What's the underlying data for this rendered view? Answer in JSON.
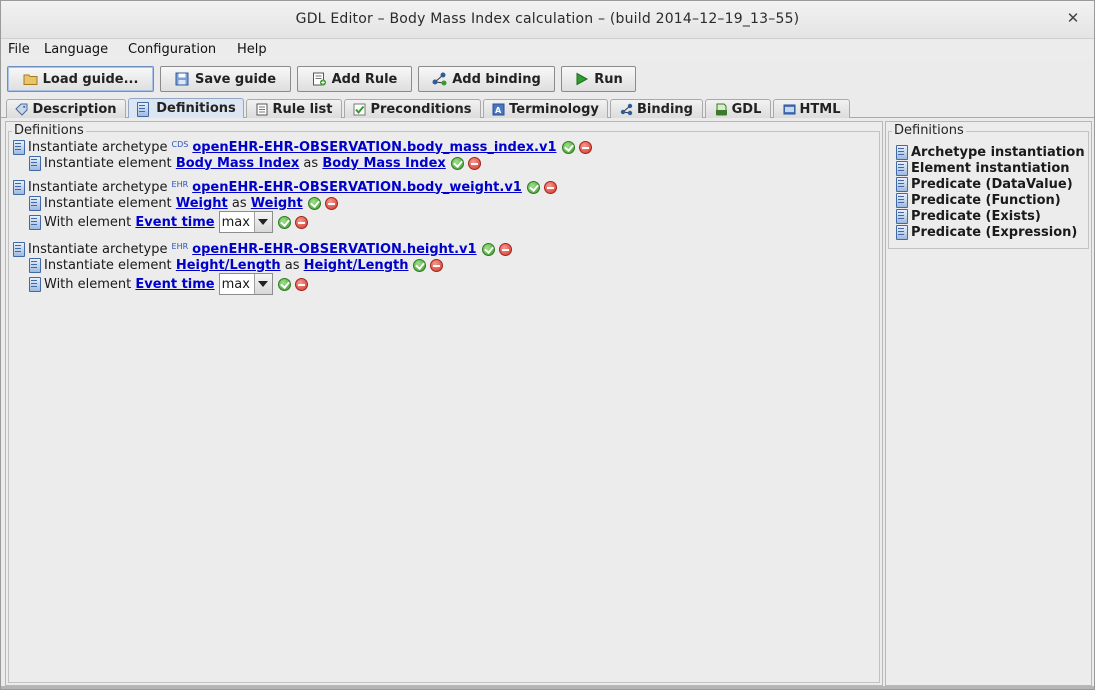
{
  "window": {
    "title": "GDL Editor – Body Mass Index calculation – (build 2014–12–19_13–55)",
    "close_glyph": "✕"
  },
  "menu": [
    "File",
    "Language",
    "Configuration",
    "Help"
  ],
  "toolbar": {
    "load_guide": "Load guide...",
    "save_guide": "Save guide",
    "add_rule": "Add Rule",
    "add_binding": "Add binding",
    "run": "Run"
  },
  "tabs": [
    {
      "label": "Description",
      "icon": "tag-icon"
    },
    {
      "label": "Definitions",
      "icon": "document-icon",
      "active": true
    },
    {
      "label": "Rule list",
      "icon": "rule-list-icon"
    },
    {
      "label": "Preconditions",
      "icon": "check-icon"
    },
    {
      "label": "Terminology",
      "icon": "terminology-icon"
    },
    {
      "label": "Binding",
      "icon": "binding-icon"
    },
    {
      "label": "GDL",
      "icon": "gdl-icon"
    },
    {
      "label": "HTML",
      "icon": "html-icon"
    }
  ],
  "definitions_panel": {
    "legend": "Definitions",
    "archetypes": [
      {
        "prefix": "Instantiate archetype",
        "tag": "CDS",
        "archetype": "openEHR-EHR-OBSERVATION.body_mass_index.v1",
        "elements": [
          {
            "prefix": "Instantiate element",
            "name": "Body Mass Index",
            "as": "as",
            "alias": "Body Mass Index"
          }
        ],
        "predicate": null
      },
      {
        "prefix": "Instantiate archetype",
        "tag": "EHR",
        "archetype": "openEHR-EHR-OBSERVATION.body_weight.v1",
        "elements": [
          {
            "prefix": "Instantiate element",
            "name": "Weight",
            "as": "as",
            "alias": "Weight"
          }
        ],
        "predicate": {
          "prefix": "With element",
          "element": "Event time",
          "function": "max"
        }
      },
      {
        "prefix": "Instantiate archetype",
        "tag": "EHR",
        "archetype": "openEHR-EHR-OBSERVATION.height.v1",
        "elements": [
          {
            "prefix": "Instantiate element",
            "name": "Height/Length",
            "as": "as",
            "alias": "Height/Length"
          }
        ],
        "predicate": {
          "prefix": "With element",
          "element": "Event time",
          "function": "max"
        }
      }
    ]
  },
  "palette": {
    "legend": "Definitions",
    "items": [
      "Archetype instantiation",
      "Element instantiation",
      "Predicate (DataValue)",
      "Predicate (Function)",
      "Predicate (Exists)",
      "Predicate (Expression)"
    ]
  },
  "colors": {
    "link": "#0000cc",
    "ok": "#3a9a2a",
    "remove": "#d2362a",
    "active_tab": "#dce6f3"
  }
}
